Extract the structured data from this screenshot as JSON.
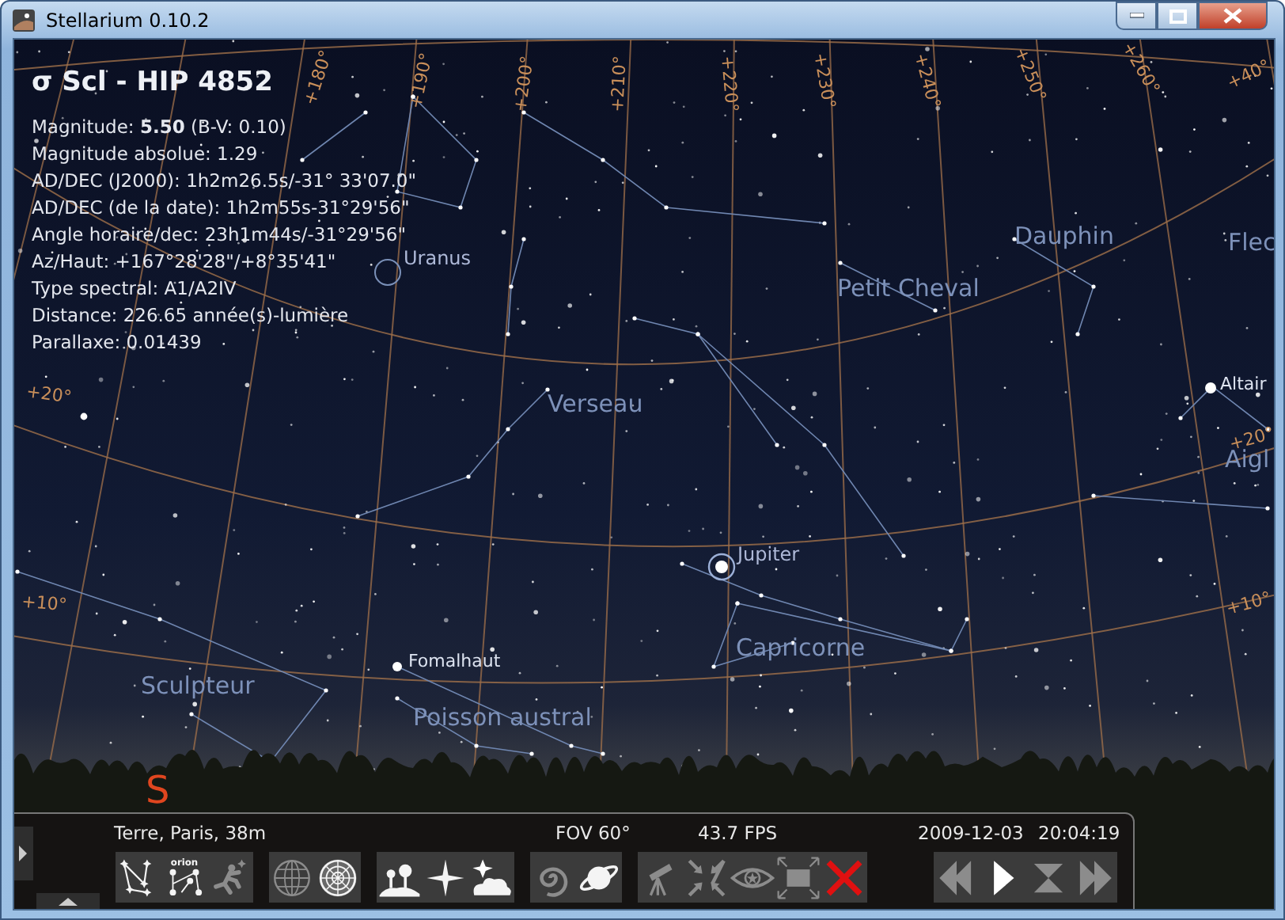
{
  "window": {
    "title": "Stellarium 0.10.2"
  },
  "object_info": {
    "title": "σ Scl - HIP 4852",
    "lines": [
      "Magnitude: **5.50** (B-V: 0.10)",
      "Magnitude absolue: 1.29",
      "AD/DEC (J2000): 1h2m26.5s/-31° 33'07.0\"",
      "AD/DEC (de la date): 1h2m55s-31°29'56\"",
      "Angle horaire/dec: 23h1m44s/-31°29'56\"",
      "Az/Haut: +167°28'28\"/+8°35'41\"",
      "Type spectral: A1/A2IV",
      "Distance: 226.65 année(s)-lumière",
      "Parallaxe: 0.01439"
    ]
  },
  "sky_labels": [
    {
      "text": "+180°",
      "kind": "grid"
    },
    {
      "text": "+190°",
      "kind": "grid"
    },
    {
      "text": "+200°",
      "kind": "grid"
    },
    {
      "text": "+210°",
      "kind": "grid"
    },
    {
      "text": "+220°",
      "kind": "grid"
    },
    {
      "text": "+230°",
      "kind": "grid"
    },
    {
      "text": "+240°",
      "kind": "grid"
    },
    {
      "text": "+250°",
      "kind": "grid"
    },
    {
      "text": "+260°",
      "kind": "grid"
    },
    {
      "text": "+40°",
      "kind": "grid"
    },
    {
      "text": "+20°",
      "kind": "grid"
    },
    {
      "text": "+10°",
      "kind": "grid"
    },
    {
      "text": "+20°",
      "kind": "grid"
    },
    {
      "text": "+10°",
      "kind": "grid"
    },
    {
      "text": "Uranus",
      "kind": "planet"
    },
    {
      "text": "Dauphin",
      "kind": "constellation"
    },
    {
      "text": "Flec",
      "kind": "constellation"
    },
    {
      "text": "Petit Cheval",
      "kind": "constellation"
    },
    {
      "text": "Verseau",
      "kind": "constellation"
    },
    {
      "text": "Altair",
      "kind": "star"
    },
    {
      "text": "Aigl",
      "kind": "constellation"
    },
    {
      "text": "Jupiter",
      "kind": "planet"
    },
    {
      "text": "Capricorne",
      "kind": "constellation"
    },
    {
      "text": "Fomalhaut",
      "kind": "star"
    },
    {
      "text": "Sculpteur",
      "kind": "constellation"
    },
    {
      "text": "Poisson austral",
      "kind": "constellation"
    },
    {
      "text": "S",
      "kind": "cardinal"
    }
  ],
  "status": {
    "location": "Terre, Paris, 38m",
    "fov": "FOV 60°",
    "fps": "43.7 FPS",
    "date": "2009-12-03",
    "time": "20:04:19"
  },
  "toolbar_groups": [
    {
      "buttons": [
        {
          "kind": "star-lines",
          "on": true
        },
        {
          "kind": "star-labels",
          "on": true,
          "label": "orion"
        },
        {
          "kind": "running-figure",
          "on": false
        }
      ]
    },
    {
      "buttons": [
        {
          "kind": "globe-grid",
          "on": false
        },
        {
          "kind": "target-grid",
          "on": true
        }
      ]
    },
    {
      "buttons": [
        {
          "kind": "landscape",
          "on": true
        },
        {
          "kind": "sparkle",
          "on": true
        },
        {
          "kind": "cloud-star",
          "on": true
        }
      ]
    },
    {
      "buttons": [
        {
          "kind": "spiral",
          "on": false
        },
        {
          "kind": "ringed-planet",
          "on": true
        }
      ]
    },
    {
      "buttons": [
        {
          "kind": "telescope",
          "on": false
        },
        {
          "kind": "arrows-in",
          "on": false
        },
        {
          "kind": "eye",
          "on": false
        },
        {
          "kind": "fullscreen",
          "on": false
        },
        {
          "kind": "quit",
          "on": false
        }
      ]
    }
  ],
  "time_buttons": [
    {
      "kind": "rewind",
      "on": false
    },
    {
      "kind": "play",
      "on": true
    },
    {
      "kind": "hourglass",
      "on": false
    },
    {
      "kind": "forward",
      "on": false
    }
  ]
}
